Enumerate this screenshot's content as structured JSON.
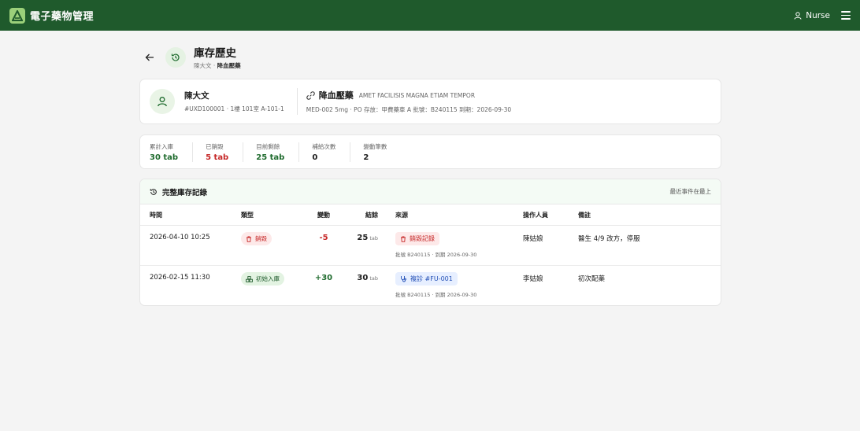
{
  "app": {
    "title": "電子藥物管理",
    "user": "Nurse"
  },
  "page": {
    "title": "庫存歷史",
    "breadcrumb_patient": "陳大文",
    "breadcrumb_sep": " · ",
    "breadcrumb_med": "降血壓藥"
  },
  "patient": {
    "name": "陳大文",
    "sub": "#UXD100001 · 1樓 101室 A-101-1"
  },
  "medication": {
    "name": "降血壓藥",
    "en": "AMET FACILISIS MAGNA ETIAM TEMPOR",
    "sub": "MED-002   5mg · PO   存放：甲費藥車 A   批號：B240115   到期：2026-09-30"
  },
  "stats": [
    {
      "label": "累計入庫",
      "value": "30 tab",
      "color": "#1f6b2e"
    },
    {
      "label": "已銷毀",
      "value": "5 tab",
      "color": "#c62828"
    },
    {
      "label": "目前剩餘",
      "value": "25 tab",
      "color": "#1f6b2e"
    },
    {
      "label": "補給次數",
      "value": "0",
      "color": "#1c1c1c"
    },
    {
      "label": "變動筆數",
      "value": "2",
      "color": "#1c1c1c"
    }
  ],
  "records": {
    "title": "完整庫存記錄",
    "note": "最近事件在最上",
    "columns": [
      "時間",
      "類型",
      "變動",
      "結餘",
      "來源",
      "操作人員",
      "備註"
    ],
    "rows": [
      {
        "time": "2026-04-10 10:25",
        "type": "銷毀",
        "delta": "-5",
        "balance": "25",
        "unit": "tab",
        "source": "銷毀記錄",
        "source_meta": "批號 B240115 · 到期 2026-09-30",
        "operator": "陳姑娘",
        "note": "醫生 4/9 改方，停服"
      },
      {
        "time": "2026-02-15 11:30",
        "type": "初始入庫",
        "delta": "+30",
        "balance": "30",
        "unit": "tab",
        "source": "複診 #FU-001",
        "source_meta": "批號 B240115 · 到期 2026-09-30",
        "operator": "李姑娘",
        "note": "初次配藥"
      }
    ]
  },
  "colors": {
    "brand": "#1f5a2c",
    "negative": "#c62828",
    "positive": "#1f6b2e",
    "link": "#2451b7"
  }
}
